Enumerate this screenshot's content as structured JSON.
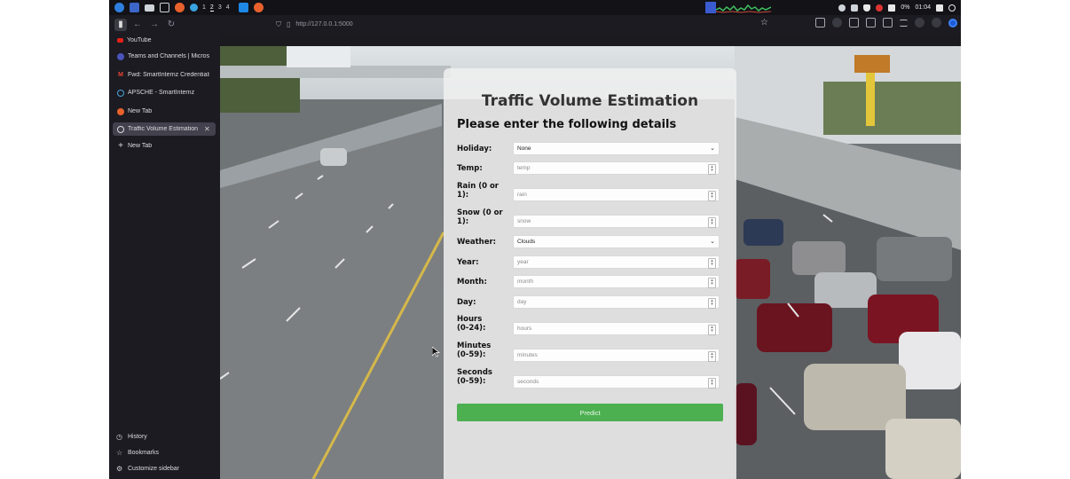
{
  "os_panel": {
    "workspaces": [
      "1",
      "2",
      "3",
      "4"
    ],
    "active_workspace": "2",
    "battery": "0%",
    "clock": "01:04",
    "icons": [
      "launcher-icon",
      "desktop-icon",
      "files-icon",
      "terminal-icon",
      "firefox-icon",
      "app-icon",
      "vscode-icon",
      "firefox-icon"
    ]
  },
  "browser": {
    "url": "http://127.0.0.1:5000",
    "tabs": [
      {
        "label": "YouTube",
        "favicon": "youtube-icon",
        "active": false
      },
      {
        "label": "Teams and Channels | Microsoft",
        "favicon": "teams-icon",
        "active": false
      },
      {
        "label": "Fwd: SmartInternz Credentials",
        "favicon": "gmail-icon",
        "active": false
      },
      {
        "label": "APSCHE - SmartInternz",
        "favicon": "globe-icon",
        "active": false
      },
      {
        "label": "New Tab",
        "favicon": "firefox-icon",
        "active": false
      },
      {
        "label": "Traffic Volume Estimation",
        "favicon": "globe-icon",
        "active": true
      },
      {
        "label": "New Tab",
        "favicon": "plus-icon",
        "active": false
      }
    ],
    "sidebar_bottom": [
      "History",
      "Bookmarks",
      "Customize sidebar"
    ]
  },
  "form": {
    "title": "Traffic Volume Estimation",
    "subtitle": "Please enter the following details",
    "fields": [
      {
        "label": "Holiday:",
        "type": "select",
        "value": "None"
      },
      {
        "label": "Temp:",
        "type": "number",
        "placeholder": "temp"
      },
      {
        "label": "Rain (0 or 1):",
        "type": "number",
        "placeholder": "rain"
      },
      {
        "label": "Snow (0 or 1):",
        "type": "number",
        "placeholder": "snow"
      },
      {
        "label": "Weather:",
        "type": "select",
        "value": "Clouds"
      },
      {
        "label": "Year:",
        "type": "number",
        "placeholder": "year"
      },
      {
        "label": "Month:",
        "type": "number",
        "placeholder": "month"
      },
      {
        "label": "Day:",
        "type": "number",
        "placeholder": "day"
      },
      {
        "label": "Hours (0-24):",
        "type": "number",
        "placeholder": "hours"
      },
      {
        "label": "Minutes (0-59):",
        "type": "number",
        "placeholder": "minutes"
      },
      {
        "label": "Seconds (0-59):",
        "type": "number",
        "placeholder": "seconds"
      }
    ],
    "submit_label": "Predict",
    "submit_color": "#4caf50"
  }
}
